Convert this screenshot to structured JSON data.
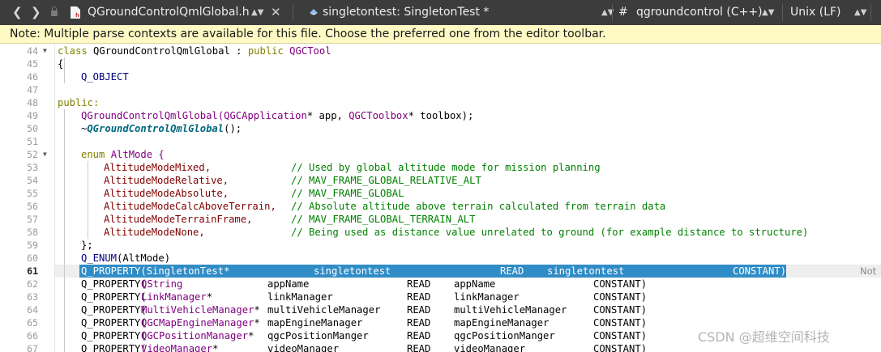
{
  "toolbar": {
    "file_name": "QGroundControlQmlGlobal.h",
    "symbol": "singletontest: SingletonTest *",
    "hash_glyph": "#",
    "project": "qgroundcontrol (C++)",
    "line_endings": "Unix (LF)"
  },
  "infobar": {
    "message": "Note: Multiple parse contexts are available for this file. Choose the preferred one from the editor toolbar."
  },
  "gutter": {
    "lines": [
      "44",
      "45",
      "46",
      "47",
      "48",
      "49",
      "50",
      "51",
      "52",
      "53",
      "54",
      "55",
      "56",
      "57",
      "58",
      "59",
      "60",
      "61",
      "62",
      "63",
      "64",
      "65",
      "66",
      "67"
    ]
  },
  "code": {
    "l44": {
      "kw": "class",
      "name": " QGroundControlQmlGlobal : ",
      "kw2": "public",
      "base": " QGCTool"
    },
    "l45": "{",
    "l46": "Q_OBJECT",
    "l48": "public:",
    "l49": {
      "name": "QGroundControlQmlGlobal(",
      "t1": "QGCApplication",
      "a1": "* app, ",
      "t2": "QGCToolbox",
      "a2": "* toolbox);"
    },
    "l50": {
      "pre": "~",
      "name": "QGroundControlQmlGlobal",
      "post": "();"
    },
    "l52": {
      "kw": "enum",
      "name": " AltMode {"
    },
    "enum_items": [
      {
        "name": "AltitudeModeMixed,",
        "comment": "// Used by global altitude mode for mission planning"
      },
      {
        "name": "AltitudeModeRelative,",
        "comment": "// MAV_FRAME_GLOBAL_RELATIVE_ALT"
      },
      {
        "name": "AltitudeModeAbsolute,",
        "comment": "// MAV_FRAME_GLOBAL"
      },
      {
        "name": "AltitudeModeCalcAboveTerrain,",
        "comment": "// Absolute altitude above terrain calculated from terrain data"
      },
      {
        "name": "AltitudeModeTerrainFrame,",
        "comment": "// MAV_FRAME_GLOBAL_TERRAIN_ALT"
      },
      {
        "name": "AltitudeModeNone,",
        "comment": "// Being used as distance value unrelated to ground (for example distance to structure)"
      }
    ],
    "l59": "};",
    "l60": {
      "mac": "Q_ENUM",
      "rest": "(AltMode)"
    },
    "l61": {
      "a": "Q_PROPERTY(SingletonTest*",
      "b": "singletontest",
      "c": "READ",
      "d": "singletontest",
      "e": "CONSTANT)"
    },
    "properties": [
      {
        "open": "Q_PROPERTY(",
        "type": "QString",
        "star": "",
        "name": "appName",
        "read": "READ",
        "getter": "appName",
        "flag": "CONSTANT)"
      },
      {
        "open": "Q_PROPERTY(",
        "type": "LinkManager",
        "star": "*",
        "name": "linkManager",
        "read": "READ",
        "getter": "linkManager",
        "flag": "CONSTANT)"
      },
      {
        "open": "Q_PROPERTY(",
        "type": "MultiVehicleManager",
        "star": "*",
        "name": "multiVehicleManager",
        "read": "READ",
        "getter": "multiVehicleManager",
        "flag": "CONSTANT)"
      },
      {
        "open": "Q_PROPERTY(",
        "type": "QGCMapEngineManager",
        "star": "*",
        "name": "mapEngineManager",
        "read": "READ",
        "getter": "mapEngineManager",
        "flag": "CONSTANT)"
      },
      {
        "open": "Q_PROPERTY(",
        "type": "QGCPositionManager",
        "star": "*",
        "name": "qgcPositionManger",
        "read": "READ",
        "getter": "qgcPositionManger",
        "flag": "CONSTANT)"
      },
      {
        "open": "Q_PROPERTY(",
        "type": "VideoManager",
        "star": "*",
        "name": "videoManager",
        "read": "READ",
        "getter": "videoManager",
        "flag": "CONSTANT)"
      }
    ]
  },
  "side_text": "Not",
  "watermark": "CSDN @超维空间科技",
  "colors": {
    "toolbar_bg": "#3c3c3c",
    "infobar_bg": "#fff9c4",
    "selection": "#308cc6",
    "keyword": "#808000",
    "type": "#800080",
    "comment": "#008000",
    "macro": "#000080",
    "enum_value": "#800000"
  }
}
